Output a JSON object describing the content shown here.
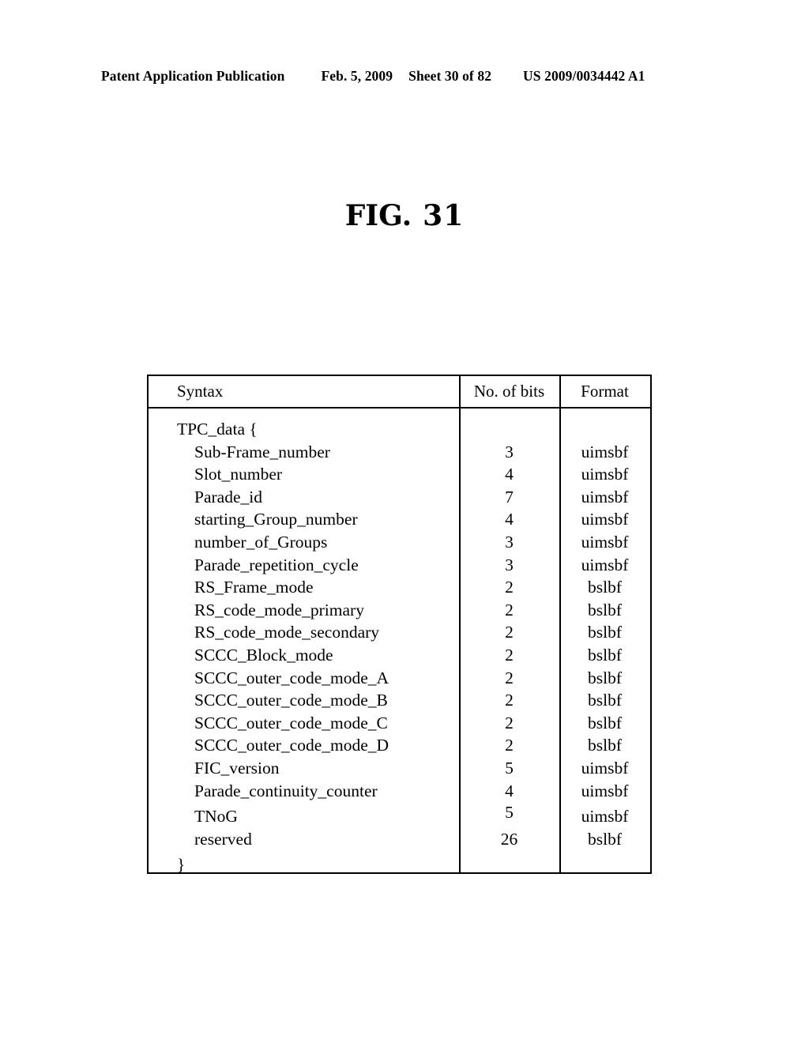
{
  "header": {
    "publication": "Patent Application Publication",
    "date": "Feb. 5, 2009",
    "sheet": "Sheet 30 of 82",
    "patent_number": "US 2009/0034442 A1"
  },
  "figure": {
    "label": "FIG.",
    "number": "31"
  },
  "table": {
    "columns": [
      "Syntax",
      "No. of bits",
      "Format"
    ],
    "rows": [
      {
        "syntax": "TPC_data {",
        "indent": 0,
        "bits": "",
        "format": ""
      },
      {
        "syntax": "Sub-Frame_number",
        "indent": 1,
        "bits": "3",
        "format": "uimsbf"
      },
      {
        "syntax": "Slot_number",
        "indent": 1,
        "bits": "4",
        "format": "uimsbf"
      },
      {
        "syntax": "Parade_id",
        "indent": 1,
        "bits": "7",
        "format": "uimsbf"
      },
      {
        "syntax": "starting_Group_number",
        "indent": 1,
        "bits": "4",
        "format": "uimsbf"
      },
      {
        "syntax": "number_of_Groups",
        "indent": 1,
        "bits": "3",
        "format": "uimsbf"
      },
      {
        "syntax": "Parade_repetition_cycle",
        "indent": 1,
        "bits": "3",
        "format": "uimsbf"
      },
      {
        "syntax": "RS_Frame_mode",
        "indent": 1,
        "bits": "2",
        "format": "bslbf"
      },
      {
        "syntax": "RS_code_mode_primary",
        "indent": 1,
        "bits": "2",
        "format": "bslbf"
      },
      {
        "syntax": "RS_code_mode_secondary",
        "indent": 1,
        "bits": "2",
        "format": "bslbf"
      },
      {
        "syntax": "SCCC_Block_mode",
        "indent": 1,
        "bits": "2",
        "format": "bslbf"
      },
      {
        "syntax": "SCCC_outer_code_mode_A",
        "indent": 1,
        "bits": "2",
        "format": "bslbf"
      },
      {
        "syntax": "SCCC_outer_code_mode_B",
        "indent": 1,
        "bits": "2",
        "format": "bslbf"
      },
      {
        "syntax": "SCCC_outer_code_mode_C",
        "indent": 1,
        "bits": "2",
        "format": "bslbf"
      },
      {
        "syntax": "SCCC_outer_code_mode_D",
        "indent": 1,
        "bits": "2",
        "format": "bslbf"
      },
      {
        "syntax": "FIC_version",
        "indent": 1,
        "bits": "5",
        "format": "uimsbf"
      },
      {
        "syntax": "Parade_continuity_counter",
        "indent": 1,
        "bits": "4",
        "format": "uimsbf"
      },
      {
        "syntax": "TNoG",
        "indent": 1,
        "bits": "5",
        "format": "uimsbf"
      },
      {
        "syntax": "reserved",
        "indent": 1,
        "bits": "26",
        "format": "bslbf"
      },
      {
        "syntax": "}",
        "indent": 0,
        "bits": "",
        "format": ""
      }
    ]
  }
}
